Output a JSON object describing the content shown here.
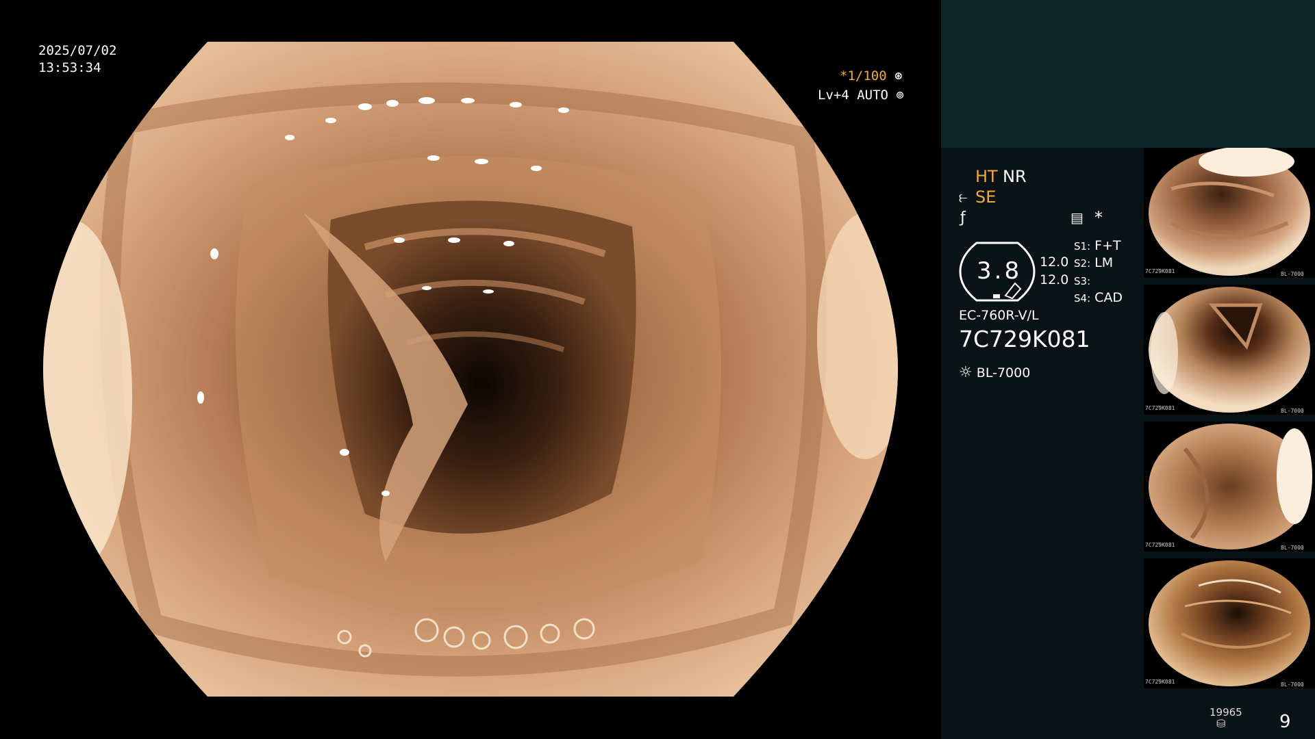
{
  "overlay": {
    "date": "2025/07/02",
    "time": "13:53:34",
    "shutter": "*1/100",
    "level": "Lv+4 AUTO"
  },
  "status": {
    "ht": "HT",
    "nr": "NR",
    "se": "SE",
    "zoom_value": "3.8",
    "value_1": "12.0",
    "value_2": "12.0",
    "s1_label": "S1:",
    "s1_value": "F+T",
    "s2_label": "S2:",
    "s2_value": "LM",
    "s3_label": "S3:",
    "s3_value": "",
    "s4_label": "S4:",
    "s4_value": "CAD",
    "scope_model": "EC-760R-V/L",
    "serial": "7C729K081",
    "light_source": "BL-7000"
  },
  "footer": {
    "storage_count": "19965",
    "capture_count": "9"
  },
  "thumbnails": [
    {
      "id": "thumb-1",
      "serial": "7C729K081",
      "source": "BL-7000"
    },
    {
      "id": "thumb-2",
      "serial": "7C729K081",
      "source": "BL-7000"
    },
    {
      "id": "thumb-3",
      "serial": "7C729K081",
      "source": "BL-7000"
    },
    {
      "id": "thumb-4",
      "serial": "7C729K081",
      "source": "BL-7000"
    }
  ],
  "colors": {
    "accent_orange": "#f4a93a",
    "panel_top": "#0d2628",
    "panel_body": "#0a1416",
    "mucosa": "#d6a27a"
  },
  "icons": [
    "settings-wheel-icon",
    "auto-iris-icon",
    "enhance-icon",
    "freeze-icon",
    "memo-icon",
    "asterisk-icon",
    "light-source-icon",
    "storage-disk-icon"
  ]
}
